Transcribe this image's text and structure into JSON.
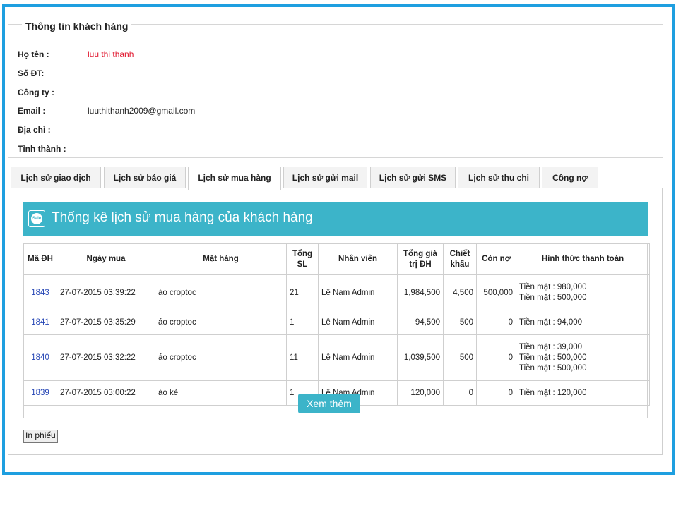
{
  "customer_info": {
    "title": "Thông tin khách hàng",
    "fields": [
      {
        "label": "Họ tên :",
        "value": "luu thi thanh"
      },
      {
        "label": "Số ĐT:",
        "value": ""
      },
      {
        "label": "Công ty :",
        "value": ""
      },
      {
        "label": "Email :",
        "value": "luuthithanh2009@gmail.com"
      },
      {
        "label": "Địa chỉ :",
        "value": ""
      },
      {
        "label": "Tỉnh thành :",
        "value": ""
      }
    ]
  },
  "tabs": [
    {
      "label": "Lịch sử giao dịch"
    },
    {
      "label": "Lịch sử báo giá"
    },
    {
      "label": "Lịch sử mua hàng",
      "active": true
    },
    {
      "label": "Lịch sử gửi mail"
    },
    {
      "label": "Lịch sử gửi SMS"
    },
    {
      "label": "Lịch sử thu chi"
    },
    {
      "label": "Công nợ"
    }
  ],
  "banner": {
    "icon": "sale-icon",
    "icon_text": "Sale",
    "title": "Thống kê lịch sử mua hàng của khách hàng",
    "color": "#3cb4c9"
  },
  "table": {
    "headers": [
      "Mã ĐH",
      "Ngày mua",
      "Mặt hàng",
      "Tổng SL",
      "Nhân viên",
      "Tổng giá trị ĐH",
      "Chiết khấu",
      "Còn nợ",
      "Hình thức thanh toán"
    ],
    "rows": [
      {
        "id": "1843",
        "date": "27-07-2015 03:39:22",
        "item": "áo croptoc",
        "qty": "21",
        "staff": "Lê Nam Admin",
        "total": "1,984,500",
        "discount": "4,500",
        "debt": "500,000",
        "payment": [
          "Tiền mặt : 980,000",
          "Tiền mặt : 500,000"
        ]
      },
      {
        "id": "1841",
        "date": "27-07-2015 03:35:29",
        "item": "áo croptoc",
        "qty": "1",
        "staff": "Lê Nam Admin",
        "total": "94,500",
        "discount": "500",
        "debt": "0",
        "payment": [
          "Tiền mặt : 94,000"
        ]
      },
      {
        "id": "1840",
        "date": "27-07-2015 03:32:22",
        "item": "áo croptoc",
        "qty": "11",
        "staff": "Lê Nam Admin",
        "total": "1,039,500",
        "discount": "500",
        "debt": "0",
        "payment": [
          "Tiền mặt : 39,000",
          "Tiền mặt : 500,000",
          "Tiền mặt : 500,000"
        ]
      },
      {
        "id": "1839",
        "date": "27-07-2015 03:00:22",
        "item": "áo kẻ",
        "qty": "1",
        "staff": "Lê Nam Admin",
        "total": "120,000",
        "discount": "0",
        "debt": "0",
        "payment": [
          "Tiền mặt : 120,000"
        ]
      }
    ]
  },
  "buttons": {
    "more": "Xem thêm",
    "print": "In phiếu"
  },
  "colors": {
    "frame_border": "#1e9fe0",
    "accent": "#3cb4c9",
    "name_value": "#e0132a",
    "order_link": "#2646b5"
  }
}
